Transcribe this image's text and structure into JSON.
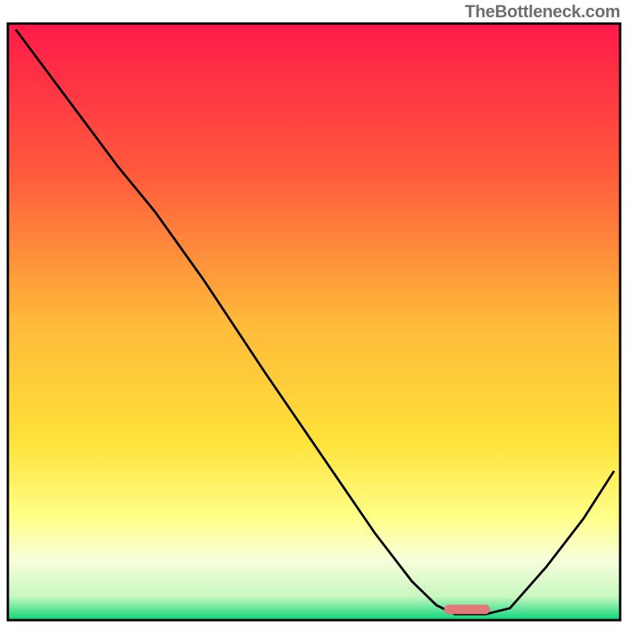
{
  "watermark": "TheBottleneck.com",
  "chart_data": {
    "type": "line",
    "title": "",
    "xlabel": "",
    "ylabel": "",
    "xlim": [
      0,
      100
    ],
    "ylim": [
      0,
      100
    ],
    "gradient_stops": [
      {
        "offset": 0,
        "color": "#ff1a4a"
      },
      {
        "offset": 25,
        "color": "#ff5a3c"
      },
      {
        "offset": 50,
        "color": "#ffb93a"
      },
      {
        "offset": 70,
        "color": "#ffe23a"
      },
      {
        "offset": 83,
        "color": "#ffff8a"
      },
      {
        "offset": 90,
        "color": "#f7ffdc"
      },
      {
        "offset": 96,
        "color": "#c9f7bf"
      },
      {
        "offset": 100,
        "color": "#09d67a"
      }
    ],
    "curve_points": [
      {
        "x": 1.3,
        "y": 99.0
      },
      {
        "x": 10.0,
        "y": 87.0
      },
      {
        "x": 18.0,
        "y": 76.0
      },
      {
        "x": 24.0,
        "y": 68.5
      },
      {
        "x": 32.0,
        "y": 57.0
      },
      {
        "x": 42.0,
        "y": 41.5
      },
      {
        "x": 52.0,
        "y": 26.5
      },
      {
        "x": 60.0,
        "y": 14.5
      },
      {
        "x": 66.0,
        "y": 6.5
      },
      {
        "x": 70.0,
        "y": 2.5
      },
      {
        "x": 73.0,
        "y": 1.0
      },
      {
        "x": 78.0,
        "y": 1.0
      },
      {
        "x": 82.0,
        "y": 2.0
      },
      {
        "x": 88.0,
        "y": 9.0
      },
      {
        "x": 94.0,
        "y": 17.0
      },
      {
        "x": 99.0,
        "y": 25.0
      }
    ],
    "marker": {
      "x": 75.0,
      "y": 1.8,
      "w": 7.5,
      "h": 1.6,
      "color": "#e07a7a",
      "rx": 6
    },
    "frame_color": "#000000",
    "frame_width": 3
  }
}
